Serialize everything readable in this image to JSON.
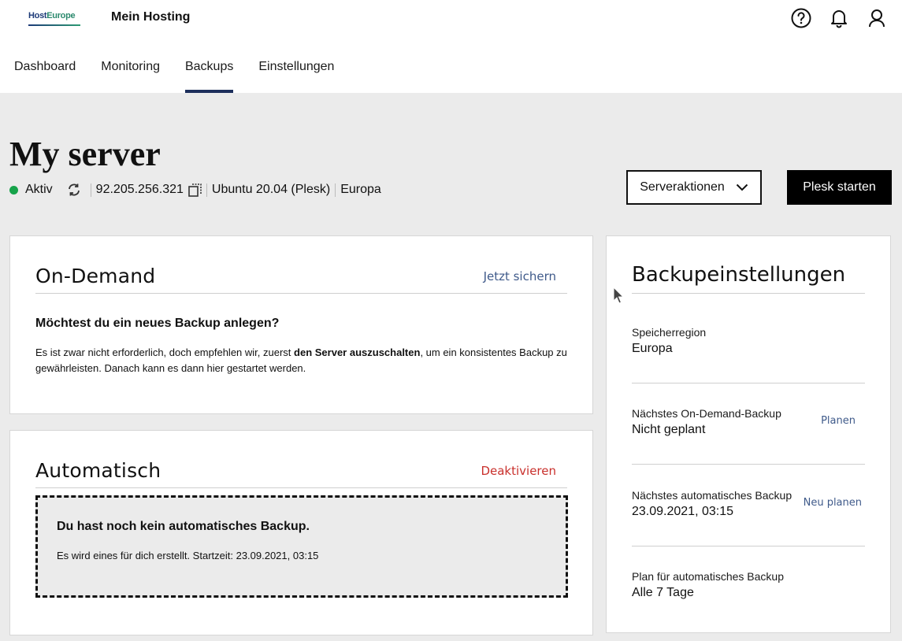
{
  "header": {
    "logo_host": "Host",
    "logo_europe": "Europe",
    "app_title": "Mein Hosting",
    "icons": [
      "help-icon",
      "bell-icon",
      "user-icon"
    ]
  },
  "tabs": [
    {
      "label": "Dashboard"
    },
    {
      "label": "Monitoring"
    },
    {
      "label": "Backups",
      "active": true
    },
    {
      "label": "Einstellungen"
    }
  ],
  "server": {
    "title": "My server",
    "status": "Aktiv",
    "status_color": "#16a34a",
    "ip": "92.205.256.321",
    "os": "Ubuntu 20.04 (Plesk)",
    "region": "Europa"
  },
  "actions": {
    "server_actions": "Serveraktionen",
    "plesk": "Plesk starten"
  },
  "ondemand": {
    "title": "On-Demand",
    "action": "Jetzt sichern",
    "question": "Möchtest du ein neues Backup anlegen?",
    "desc_pre": "Es ist zwar nicht erforderlich, doch empfehlen wir, zuerst ",
    "desc_bold": "den Server auszuschalten",
    "desc_post": ", um ein konsistentes Backup zu gewährleisten. Danach kann es dann hier gestartet werden."
  },
  "automatic": {
    "title": "Automatisch",
    "action": "Deaktivieren",
    "empty_title": "Du hast noch kein automatisches Backup.",
    "empty_text": "Es wird eines für dich erstellt. Startzeit: 23.09.2021, 03:15"
  },
  "settings": {
    "title": "Backupeinstellungen",
    "items": [
      {
        "label": "Speicherregion",
        "value": "Europa",
        "action": ""
      },
      {
        "label": "Nächstes On-Demand-Backup",
        "value": "Nicht geplant",
        "action": "Planen"
      },
      {
        "label": "Nächstes automatisches Backup",
        "value": "23.09.2021, 03:15",
        "action": "Neu planen"
      },
      {
        "label": "Plan für automatisches Backup",
        "value": "Alle 7 Tage",
        "action": ""
      }
    ]
  }
}
